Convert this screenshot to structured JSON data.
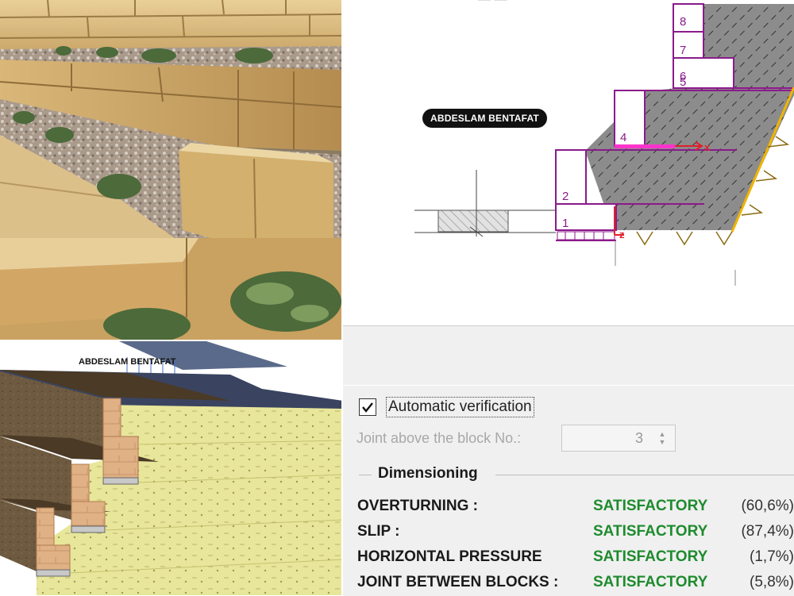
{
  "watermark": {
    "text": "ABDESLAM BENTAFAT"
  },
  "model": {
    "title": "ABDESLAM BENTAFAT"
  },
  "diagram": {
    "block_numbers": [
      "1",
      "2",
      "4",
      "5",
      "6",
      "7",
      "8"
    ],
    "axis_x_label": "x",
    "axis_z_label": "z"
  },
  "panel": {
    "auto_verification": {
      "label": "Automatic verification",
      "checked": true
    },
    "joint": {
      "label": "Joint above the block No.:",
      "value": "3"
    },
    "dimensioning": {
      "title": "Dimensioning",
      "rows": [
        {
          "name": "OVERTURNING :",
          "status": "SATISFACTORY",
          "percent": "(60,6%)"
        },
        {
          "name": "SLIP :",
          "status": "SATISFACTORY",
          "percent": "(87,4%)"
        },
        {
          "name": "HORIZONTAL PRESSURE",
          "status": "SATISFACTORY",
          "percent": "(1,7%)"
        },
        {
          "name": "JOINT BETWEEN BLOCKS :",
          "status": "SATISFACTORY",
          "percent": "(5,8%)"
        }
      ]
    }
  },
  "colors": {
    "satisfactory": "#1e8b2e",
    "block_outline": "#8b1a8b",
    "axis": "#e0202a",
    "backfill": "#8a8a8a"
  }
}
